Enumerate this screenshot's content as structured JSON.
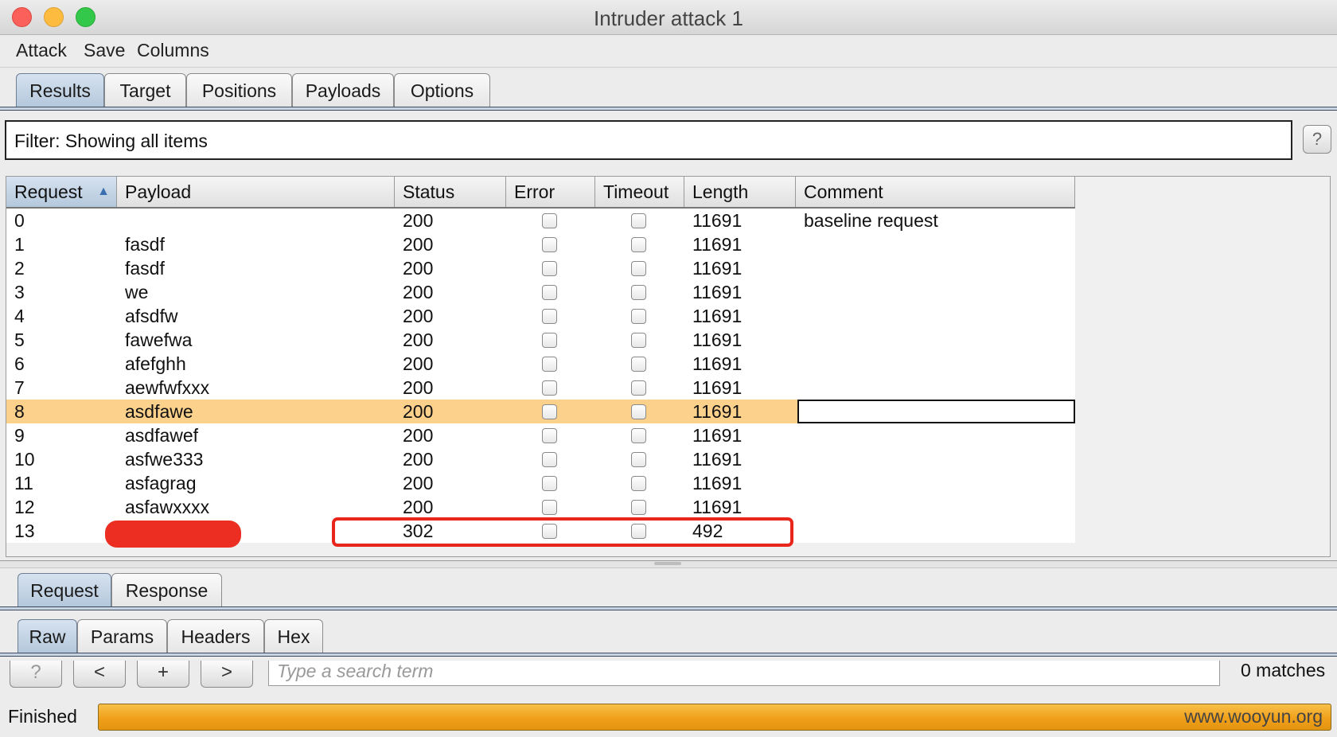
{
  "window": {
    "title": "Intruder attack 1"
  },
  "menu": [
    "Attack",
    "Save",
    "Columns"
  ],
  "tabs": [
    "Results",
    "Target",
    "Positions",
    "Payloads",
    "Options"
  ],
  "filter": {
    "text": "Filter: Showing all items",
    "help": "?"
  },
  "table": {
    "columns": [
      "Request",
      "Payload",
      "Status",
      "Error",
      "Timeout",
      "Length",
      "Comment"
    ],
    "sort": {
      "column": "Request",
      "direction": "ascending"
    },
    "rows": [
      {
        "request": "0",
        "payload": "",
        "status": "200",
        "error": false,
        "timeout": false,
        "length": "11691",
        "comment": "baseline request"
      },
      {
        "request": "1",
        "payload": "fasdf",
        "status": "200",
        "error": false,
        "timeout": false,
        "length": "11691",
        "comment": ""
      },
      {
        "request": "2",
        "payload": "fasdf",
        "status": "200",
        "error": false,
        "timeout": false,
        "length": "11691",
        "comment": ""
      },
      {
        "request": "3",
        "payload": "we",
        "status": "200",
        "error": false,
        "timeout": false,
        "length": "11691",
        "comment": ""
      },
      {
        "request": "4",
        "payload": "afsdfw",
        "status": "200",
        "error": false,
        "timeout": false,
        "length": "11691",
        "comment": ""
      },
      {
        "request": "5",
        "payload": "fawefwa",
        "status": "200",
        "error": false,
        "timeout": false,
        "length": "11691",
        "comment": ""
      },
      {
        "request": "6",
        "payload": "afefghh",
        "status": "200",
        "error": false,
        "timeout": false,
        "length": "11691",
        "comment": ""
      },
      {
        "request": "7",
        "payload": "aewfwfxxx",
        "status": "200",
        "error": false,
        "timeout": false,
        "length": "11691",
        "comment": ""
      },
      {
        "request": "8",
        "payload": "asdfawe",
        "status": "200",
        "error": false,
        "timeout": false,
        "length": "11691",
        "comment": "",
        "selected": true
      },
      {
        "request": "9",
        "payload": "asdfawef",
        "status": "200",
        "error": false,
        "timeout": false,
        "length": "11691",
        "comment": ""
      },
      {
        "request": "10",
        "payload": "asfwe333",
        "status": "200",
        "error": false,
        "timeout": false,
        "length": "11691",
        "comment": ""
      },
      {
        "request": "11",
        "payload": "asfagrag",
        "status": "200",
        "error": false,
        "timeout": false,
        "length": "11691",
        "comment": ""
      },
      {
        "request": "12",
        "payload": "asfawxxxx",
        "status": "200",
        "error": false,
        "timeout": false,
        "length": "11691",
        "comment": ""
      },
      {
        "request": "13",
        "payload": "",
        "status": "302",
        "error": false,
        "timeout": false,
        "length": "492",
        "comment": "",
        "payload_redacted": true
      }
    ]
  },
  "viewer_tabs": [
    "Request",
    "Response"
  ],
  "sub_tabs": [
    "Raw",
    "Params",
    "Headers",
    "Hex"
  ],
  "search": {
    "help": "?",
    "prev": "<",
    "add": "+",
    "next": ">",
    "placeholder": "Type a search term",
    "matches": "0 matches"
  },
  "status": {
    "text": "Finished",
    "progress": 1.0,
    "watermark": "www.wooyun.org"
  },
  "colors": {
    "selected_row": "#fcd18c",
    "progress": "#f0a019",
    "annotation": "#e8261c"
  }
}
